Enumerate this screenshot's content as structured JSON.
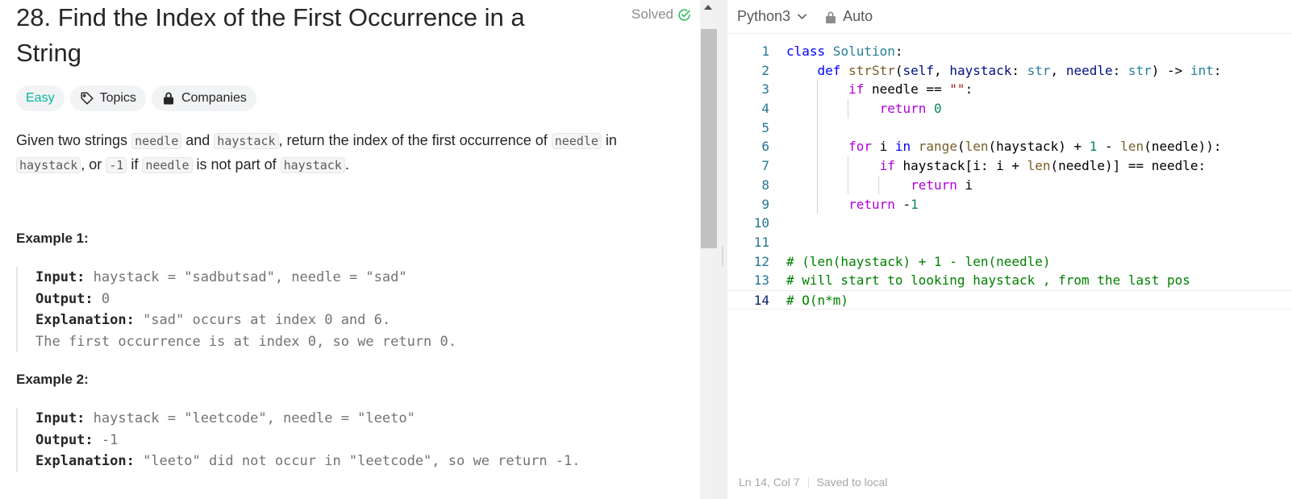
{
  "problem": {
    "title": "28. Find the Index of the First Occurrence in a String",
    "solved_label": "Solved",
    "tags": {
      "difficulty": "Easy",
      "topics": "Topics",
      "companies": "Companies"
    },
    "description": {
      "p1": "Given two strings ",
      "c1": "needle",
      "p2": " and ",
      "c2": "haystack",
      "p3": ", return the index of the first occurrence of ",
      "c3": "needle",
      "p4": " in ",
      "c4": "haystack",
      "p5": ", or ",
      "c5": "-1",
      "p6": " if ",
      "c6": "needle",
      "p7": " is not part of ",
      "c7": "haystack",
      "p8": "."
    },
    "examples": [
      {
        "title": "Example 1:",
        "input_label": "Input:",
        "input": " haystack = \"sadbutsad\", needle = \"sad\"",
        "output_label": "Output:",
        "output": " 0",
        "explanation_label": "Explanation:",
        "explanation": " \"sad\" occurs at index 0 and 6.",
        "explanation_2": "The first occurrence is at index 0, so we return 0."
      },
      {
        "title": "Example 2:",
        "input_label": "Input:",
        "input": " haystack = \"leetcode\", needle = \"leeto\"",
        "output_label": "Output:",
        "output": " -1",
        "explanation_label": "Explanation:",
        "explanation": " \"leeto\" did not occur in \"leetcode\", so we return -1."
      }
    ]
  },
  "editor": {
    "language": "Python3",
    "mode": "Auto",
    "line_numbers": [
      "1",
      "2",
      "3",
      "4",
      "5",
      "6",
      "7",
      "8",
      "9",
      "10",
      "11",
      "12",
      "13",
      "14"
    ],
    "status": {
      "position": "Ln 14, Col 7",
      "saved": "Saved to local"
    }
  },
  "colors": {
    "easy": "#00b8a3",
    "solved": "#2cbb5d",
    "accent": "#0000ff"
  },
  "icons": [
    "check-circle-icon",
    "tag-icon",
    "lock-icon",
    "chevron-down-icon",
    "scroll-up-arrow-icon"
  ]
}
